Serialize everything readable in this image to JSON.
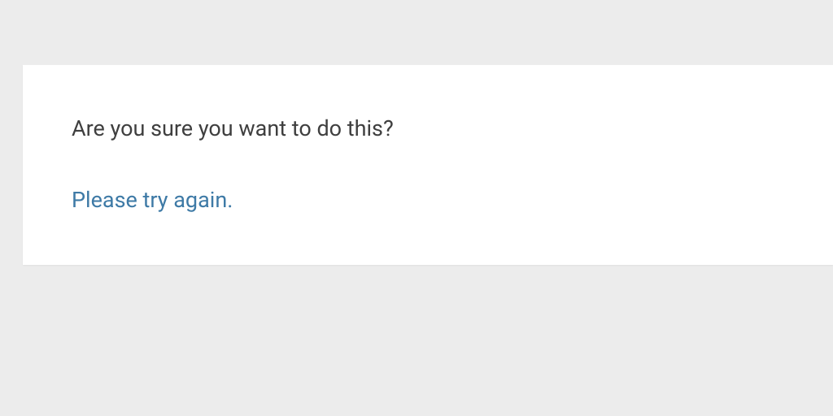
{
  "dialog": {
    "message": "Are you sure you want to do this?",
    "retry_label": "Please try again."
  }
}
